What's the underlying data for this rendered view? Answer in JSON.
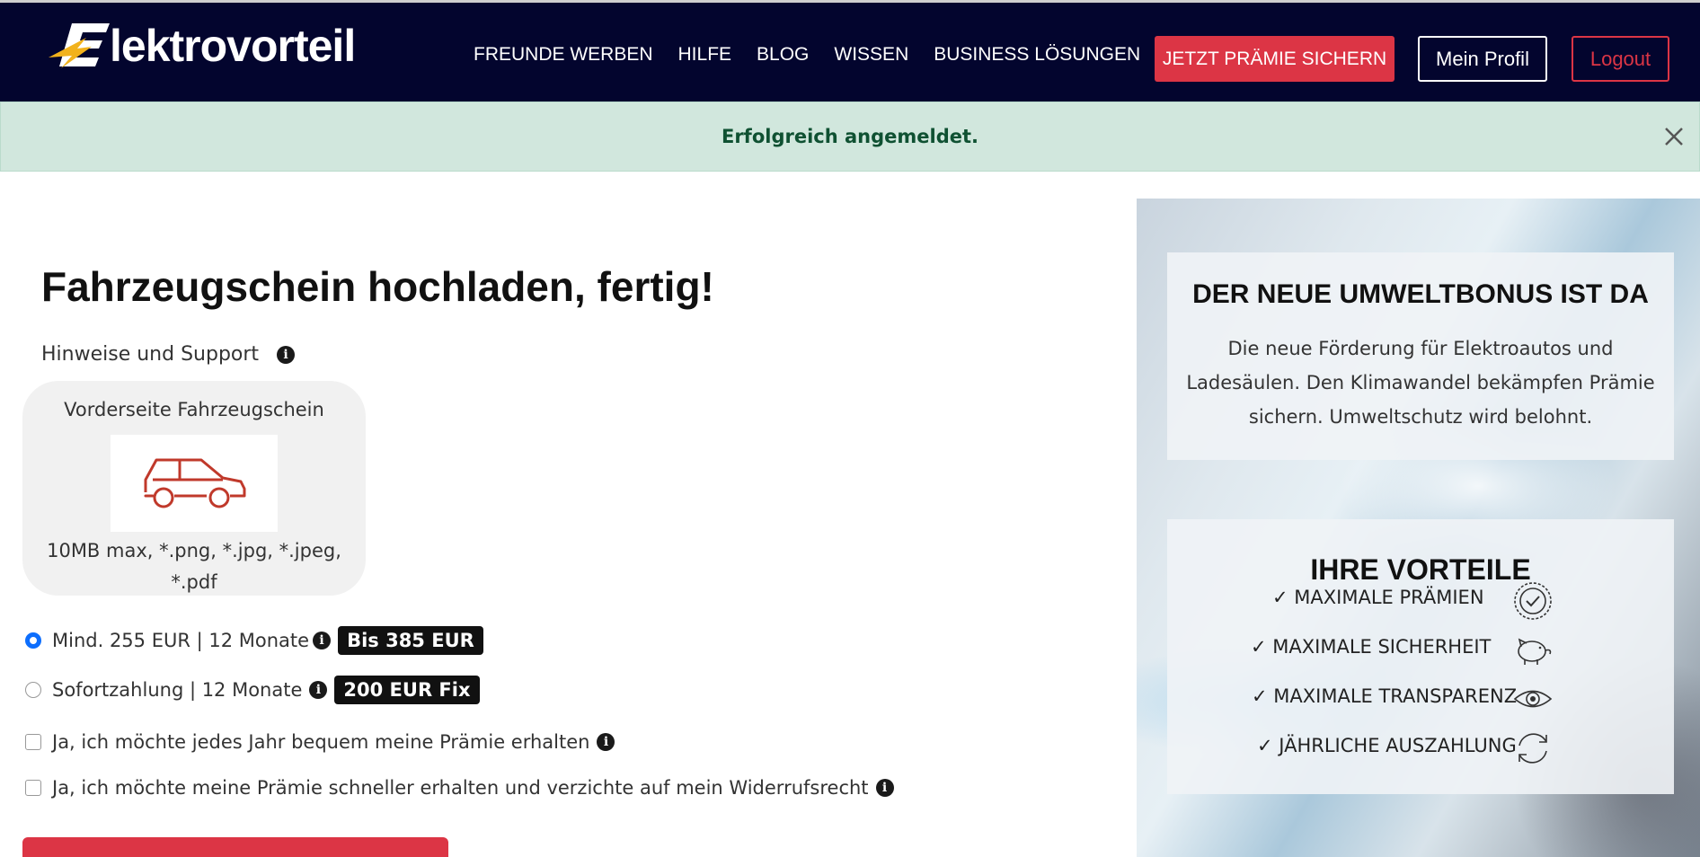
{
  "header": {
    "logo_text": "lektrovorteil",
    "nav": [
      "FREUNDE WERBEN",
      "HILFE",
      "BLOG",
      "WISSEN",
      "BUSINESS LÖSUNGEN"
    ],
    "cta_label": "JETZT PRÄMIE SICHERN",
    "profile_label": "Mein Profil",
    "logout_label": "Logout"
  },
  "alert": {
    "message": "Erfolgreich angemeldet."
  },
  "main": {
    "title": "Fahrzeugschein hochladen, fertig!",
    "hint_label": "Hinweise und Support",
    "upload": {
      "title": "Vorderseite Fahrzeugschein",
      "formats": "10MB max, *.png, *.jpg, *.jpeg, *.pdf"
    },
    "options": [
      {
        "label": "Mind. 255 EUR | 12 Monate",
        "badge": "Bis 385 EUR",
        "selected": true
      },
      {
        "label": "Sofortzahlung | 12 Monate",
        "badge": "200 EUR Fix",
        "selected": false
      }
    ],
    "checkboxes": [
      {
        "label": "Ja, ich möchte jedes Jahr bequem meine Prämie erhalten",
        "checked": false
      },
      {
        "label": "Ja, ich möchte meine Prämie schneller erhalten und verzichte auf mein Widerrufsrecht",
        "checked": false
      }
    ]
  },
  "sidebar": {
    "umweltbonus": {
      "title": "DER NEUE UMWELTBONUS IST DA",
      "text": "Die neue Förderung für Elektroautos und Ladesäulen. Den Klimawandel bekämpfen Prämie sichern. Umweltschutz wird belohnt."
    },
    "vorteile": {
      "title": "IHRE VORTEILE",
      "items": [
        {
          "label": "✓ MAXIMALE PRÄMIEN",
          "icon": "badge-check-icon"
        },
        {
          "label": "✓ MAXIMALE SICHERHEIT",
          "icon": "piggy-bank-icon"
        },
        {
          "label": "✓ MAXIMALE TRANSPARENZ",
          "icon": "eye-icon"
        },
        {
          "label": "✓ JÄHRLICHE AUSZAHLUNG",
          "icon": "refresh-icon"
        }
      ]
    }
  },
  "colors": {
    "navbar": "#03052e",
    "accent_red": "#dc3545",
    "alert_bg": "#d1e7dd",
    "alert_text": "#0f5132",
    "radio_blue": "#0d6efd"
  }
}
